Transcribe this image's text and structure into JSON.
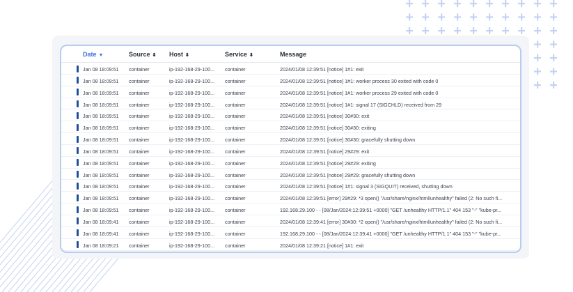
{
  "table": {
    "columns": {
      "date": "Date",
      "source": "Source",
      "host": "Host",
      "service": "Service",
      "message": "Message"
    },
    "sort_icons": {
      "date": "▼",
      "source": "⬍",
      "host": "⬍",
      "service": "⬍"
    },
    "rows": [
      {
        "date": "Jan 08 18:09:51",
        "source": "container",
        "host": "ip-192-168-29-100...",
        "service": "container",
        "message": "2024/01/08 12:39:51 [notice] 1#1: exit"
      },
      {
        "date": "Jan 08 18:09:51",
        "source": "container",
        "host": "ip-192-168-29-100...",
        "service": "container",
        "message": "2024/01/08 12:39:51 [notice] 1#1: worker process 30 exited with code 0"
      },
      {
        "date": "Jan 08 18:09:51",
        "source": "container",
        "host": "ip-192-168-29-100...",
        "service": "container",
        "message": "2024/01/08 12:39:51 [notice] 1#1: worker process 29 exited with code 0"
      },
      {
        "date": "Jan 08 18:09:51",
        "source": "container",
        "host": "ip-192-168-29-100...",
        "service": "container",
        "message": "2024/01/08 12:39:51 [notice] 1#1: signal 17 (SIGCHLD) received from 29"
      },
      {
        "date": "Jan 08 18:09:51",
        "source": "container",
        "host": "ip-192-168-29-100...",
        "service": "container",
        "message": "2024/01/08 12:39:51 [notice] 30#30: exit"
      },
      {
        "date": "Jan 08 18:09:51",
        "source": "container",
        "host": "ip-192-168-29-100...",
        "service": "container",
        "message": "2024/01/08 12:39:51 [notice] 30#30: exiting"
      },
      {
        "date": "Jan 08 18:09:51",
        "source": "container",
        "host": "ip-192-168-29-100...",
        "service": "container",
        "message": "2024/01/08 12:39:51 [notice] 30#30: gracefully shutting down"
      },
      {
        "date": "Jan 08 18:09:51",
        "source": "container",
        "host": "ip-192-168-29-100...",
        "service": "container",
        "message": "2024/01/08 12:39:51 [notice] 29#29: exit"
      },
      {
        "date": "Jan 08 18:09:51",
        "source": "container",
        "host": "ip-192-168-29-100...",
        "service": "container",
        "message": "2024/01/08 12:39:51 [notice] 29#29: exiting"
      },
      {
        "date": "Jan 08 18:09:51",
        "source": "container",
        "host": "ip-192-168-29-100...",
        "service": "container",
        "message": "2024/01/08 12:39:51 [notice] 29#29: gracefully shutting down"
      },
      {
        "date": "Jan 08 18:09:51",
        "source": "container",
        "host": "ip-192-168-29-100...",
        "service": "container",
        "message": "2024/01/08 12:39:51 [notice] 1#1: signal 3 (SIGQUIT) received, shutting down"
      },
      {
        "date": "Jan 08 18:09:51",
        "source": "container",
        "host": "ip-192-168-29-100...",
        "service": "container",
        "message": "2024/01/08 12:39:51 [error] 29#29: *3 open() \"/usr/share/nginx/html/unhealthy\" failed (2: No such fi..."
      },
      {
        "date": "Jan 08 18:09:51",
        "source": "container",
        "host": "ip-192-168-29-100...",
        "service": "container",
        "message": "192.168.29.100 - - [08/Jan/2024:12:39:51 +0000] \"GET /unhealthy HTTP/1.1\" 404 153 \"-\" \"kube-pr..."
      },
      {
        "date": "Jan 08 18:09:41",
        "source": "container",
        "host": "ip-192-168-29-100...",
        "service": "container",
        "message": "2024/01/08 12:39:41 [error] 30#30: *2 open() \"/usr/share/nginx/html/unhealthy\" failed (2: No such fi..."
      },
      {
        "date": "Jan 08 18:09:41",
        "source": "container",
        "host": "ip-192-168-29-100...",
        "service": "container",
        "message": "192.168.29.100 - - [08/Jan/2024:12:39:41 +0000] \"GET /unhealthy HTTP/1.1\" 404 153 \"-\" \"kube-pr..."
      },
      {
        "date": "Jan 08 18:09:21",
        "source": "container",
        "host": "ip-192-168-29-100...",
        "service": "container",
        "message": "2024/01/08 12:39:21 [notice] 1#1: exit"
      }
    ]
  },
  "colors": {
    "accent": "#3b6fd6",
    "status_bar": "#1f4f99",
    "panel_border": "#b7ccef",
    "decor_plus": "#c3d3f2",
    "decor_lines": "#c3d3f2"
  }
}
